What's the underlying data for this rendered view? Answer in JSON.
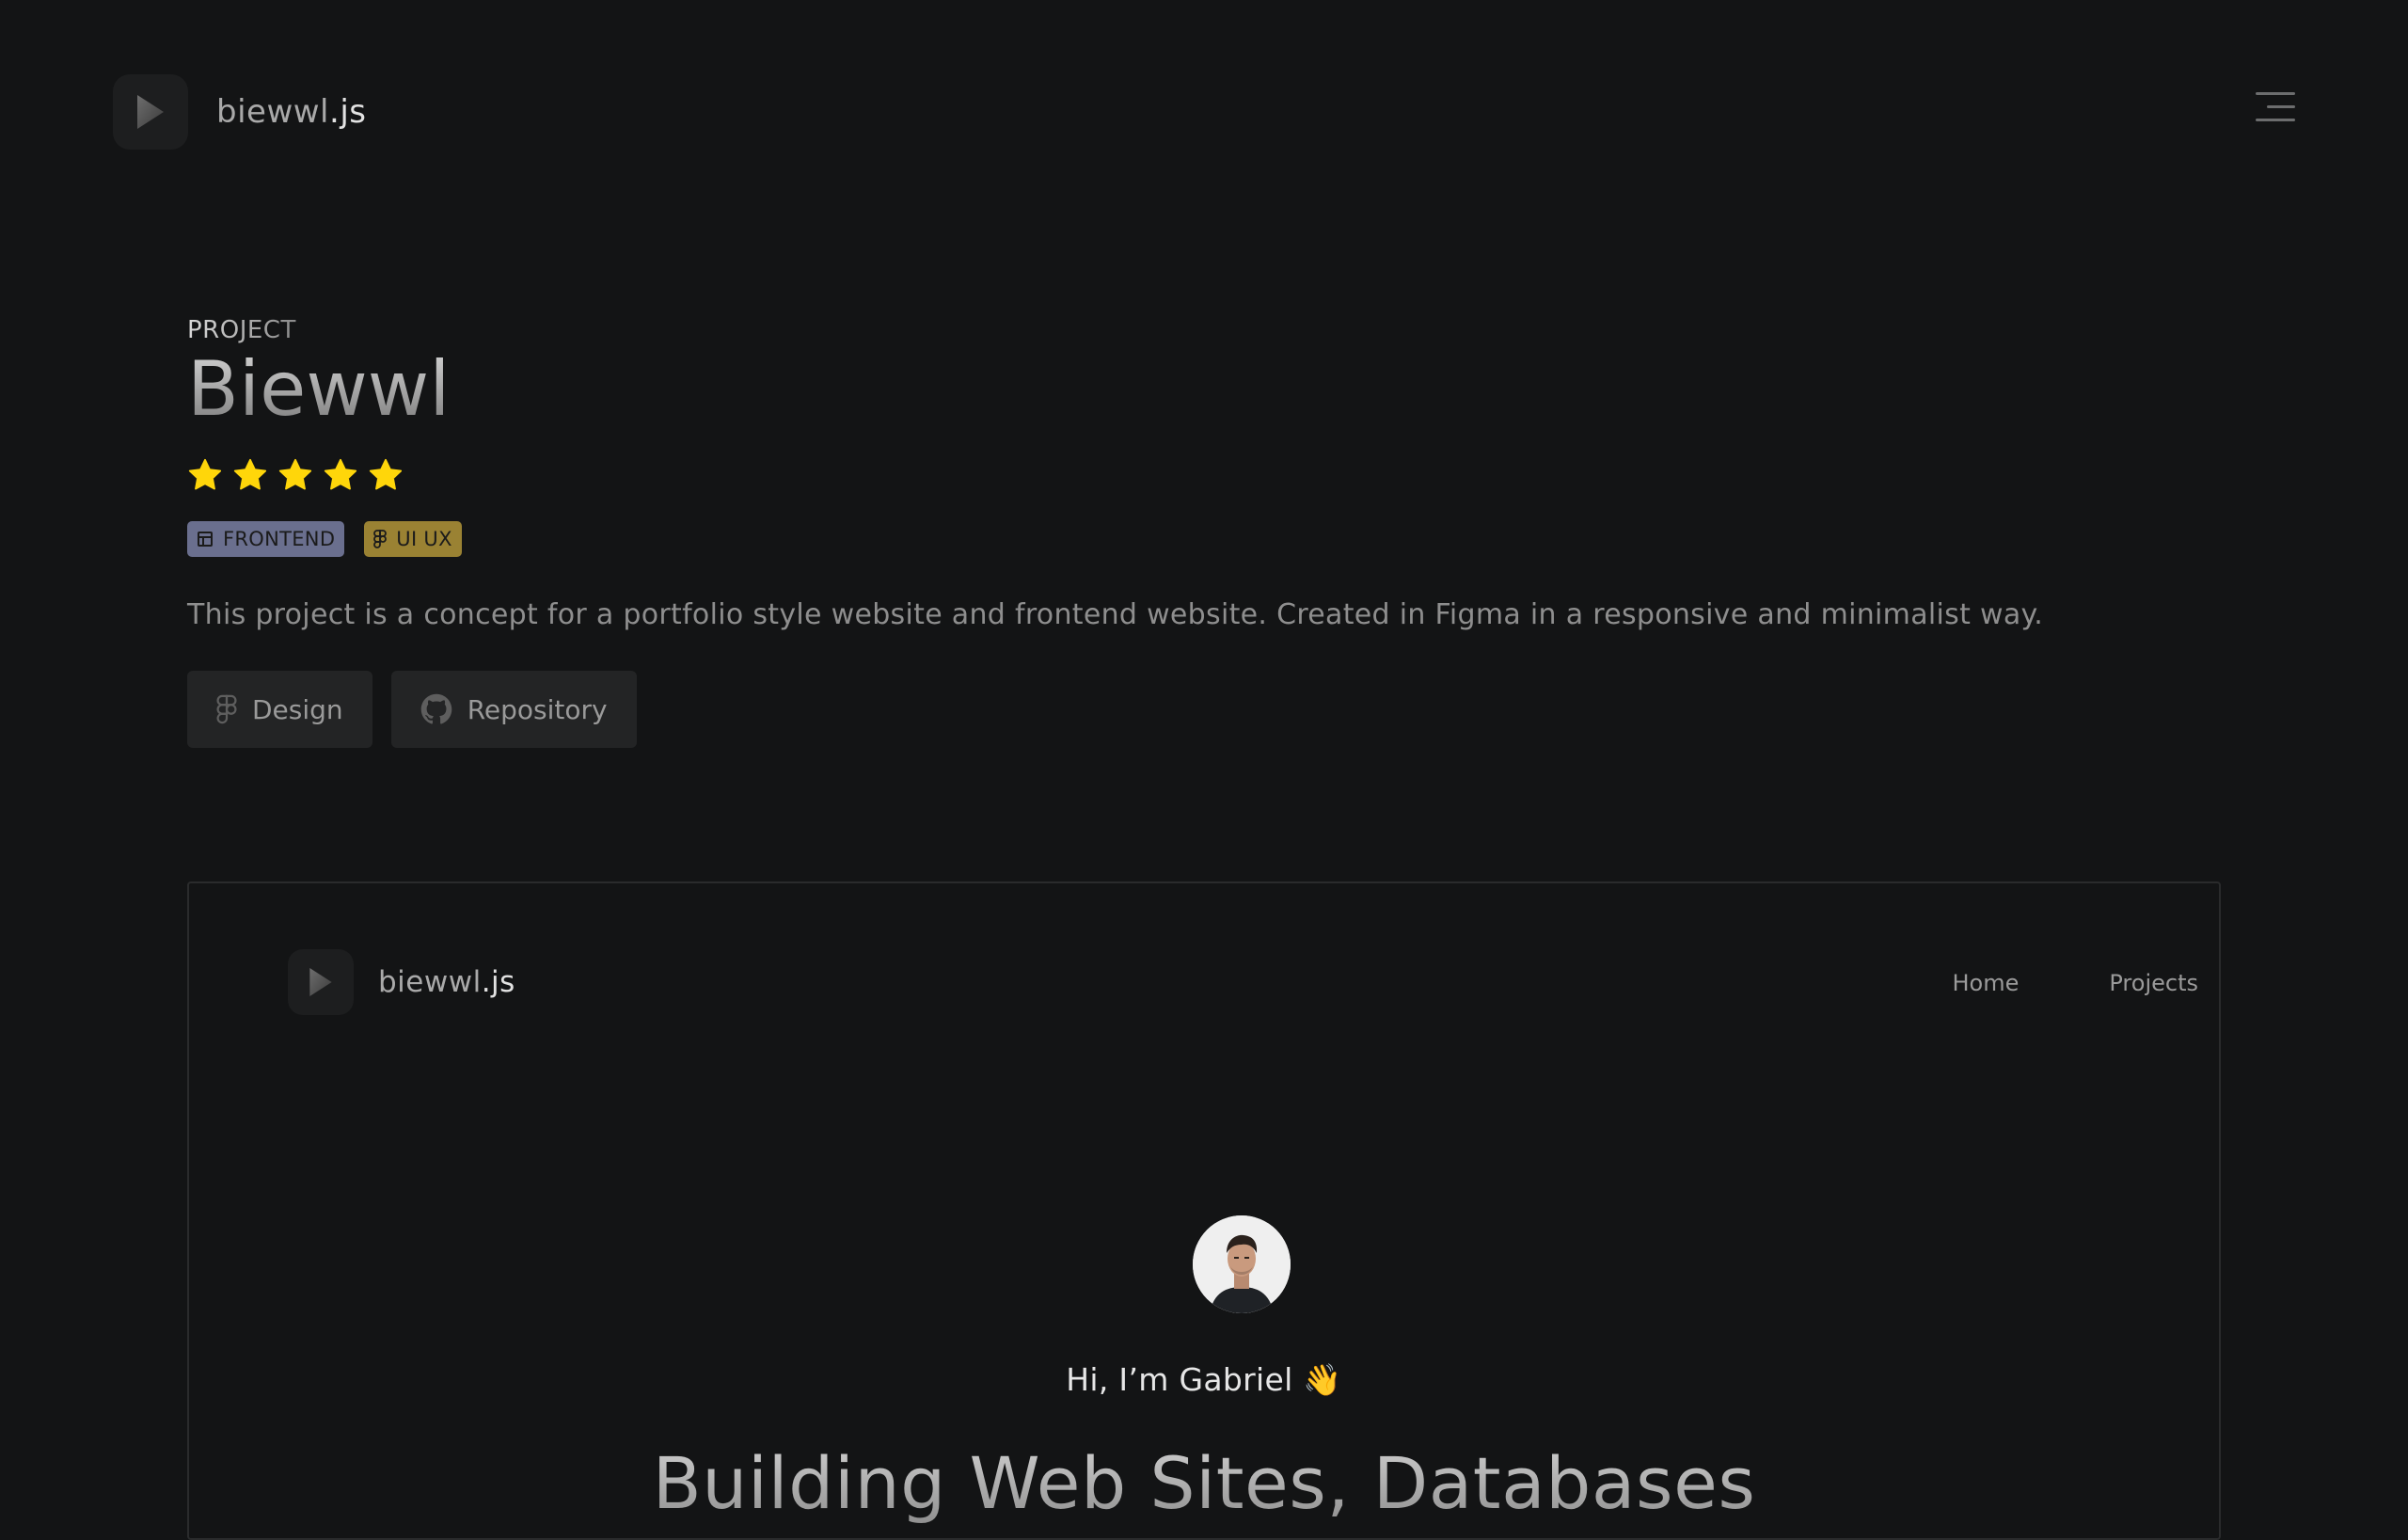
{
  "header": {
    "brand_name": "biewwl",
    "brand_ext": ".js"
  },
  "project": {
    "eyebrow": "PROJECT",
    "title": "Biewwl",
    "rating": 5,
    "rating_max": 5,
    "star_color": "#FFD60A",
    "tags": [
      {
        "label": "FRONTEND",
        "icon": "layout-icon",
        "color": "#6a6f8e"
      },
      {
        "label": "UI UX",
        "icon": "figma-icon",
        "color": "#9a8233"
      }
    ],
    "description": "This project is a concept for a portfolio style website and frontend website. Created in Figma in a responsive and minimalist way.",
    "actions": [
      {
        "label": "Design",
        "icon": "figma-icon"
      },
      {
        "label": "Repository",
        "icon": "github-icon"
      }
    ]
  },
  "preview": {
    "brand_name": "biewwl",
    "brand_ext": ".js",
    "nav": [
      "Home",
      "Projects"
    ],
    "greeting": "Hi, I’m Gabriel 👋",
    "headline": "Building Web Sites, Databases"
  }
}
